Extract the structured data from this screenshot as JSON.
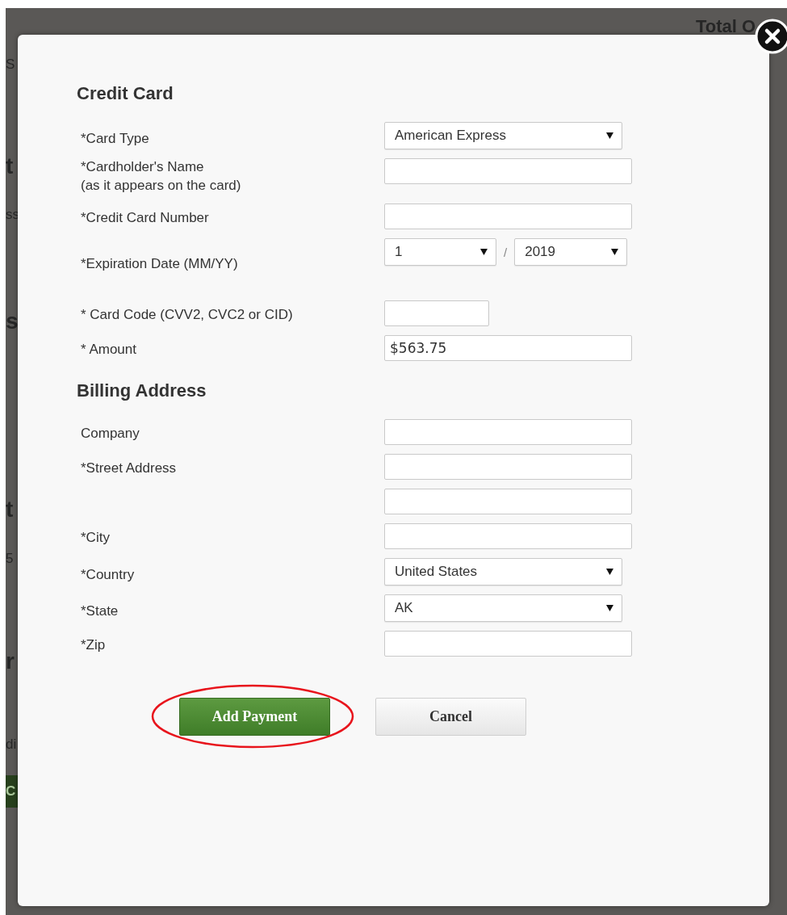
{
  "background": {
    "fragments": [
      {
        "text": "S",
        "kind": "text"
      },
      {
        "text": "t",
        "kind": "heading"
      },
      {
        "text": "ss",
        "kind": "text"
      },
      {
        "text": "s",
        "kind": "heading"
      },
      {
        "text": "t",
        "kind": "heading"
      },
      {
        "text": "5",
        "kind": "text"
      },
      {
        "text": "r",
        "kind": "heading"
      },
      {
        "text": "di",
        "kind": "text"
      },
      {
        "text": "C",
        "kind": "button"
      }
    ],
    "side_heading": "Total O"
  },
  "dialog": {
    "sections": [
      {
        "title": "Credit Card",
        "fields": [
          {
            "label": "*Card Type",
            "kind": "select",
            "value": "American Express"
          },
          {
            "label": "*Cardholder's Name",
            "note": "(as it appears on the card)",
            "kind": "text"
          },
          {
            "label": "*Credit Card Number",
            "kind": "text"
          },
          {
            "label": "*Expiration Date (MM/YY)",
            "kind": "date",
            "month": "1",
            "separator": "/",
            "year": "2019"
          },
          {
            "label": "* Card Code (CVV2, CVC2 or CID)",
            "kind": "short"
          },
          {
            "label": "* Amount",
            "kind": "text",
            "value": "$563.75"
          }
        ]
      },
      {
        "title": "Billing Address",
        "fields": [
          {
            "label": "Company",
            "kind": "text"
          },
          {
            "label": "*Street Address",
            "kind": "text"
          },
          {
            "kind": "text"
          },
          {
            "label": "*City",
            "kind": "text"
          },
          {
            "label": "*Country",
            "kind": "select",
            "value": "United States"
          },
          {
            "label": "*State",
            "kind": "select",
            "value": "AK"
          },
          {
            "label": "*Zip",
            "kind": "text"
          }
        ]
      }
    ],
    "buttons": [
      {
        "label": "Add Payment",
        "kind": "primary",
        "circled": true
      },
      {
        "label": "Cancel",
        "kind": "secondary",
        "circled": false
      }
    ]
  }
}
